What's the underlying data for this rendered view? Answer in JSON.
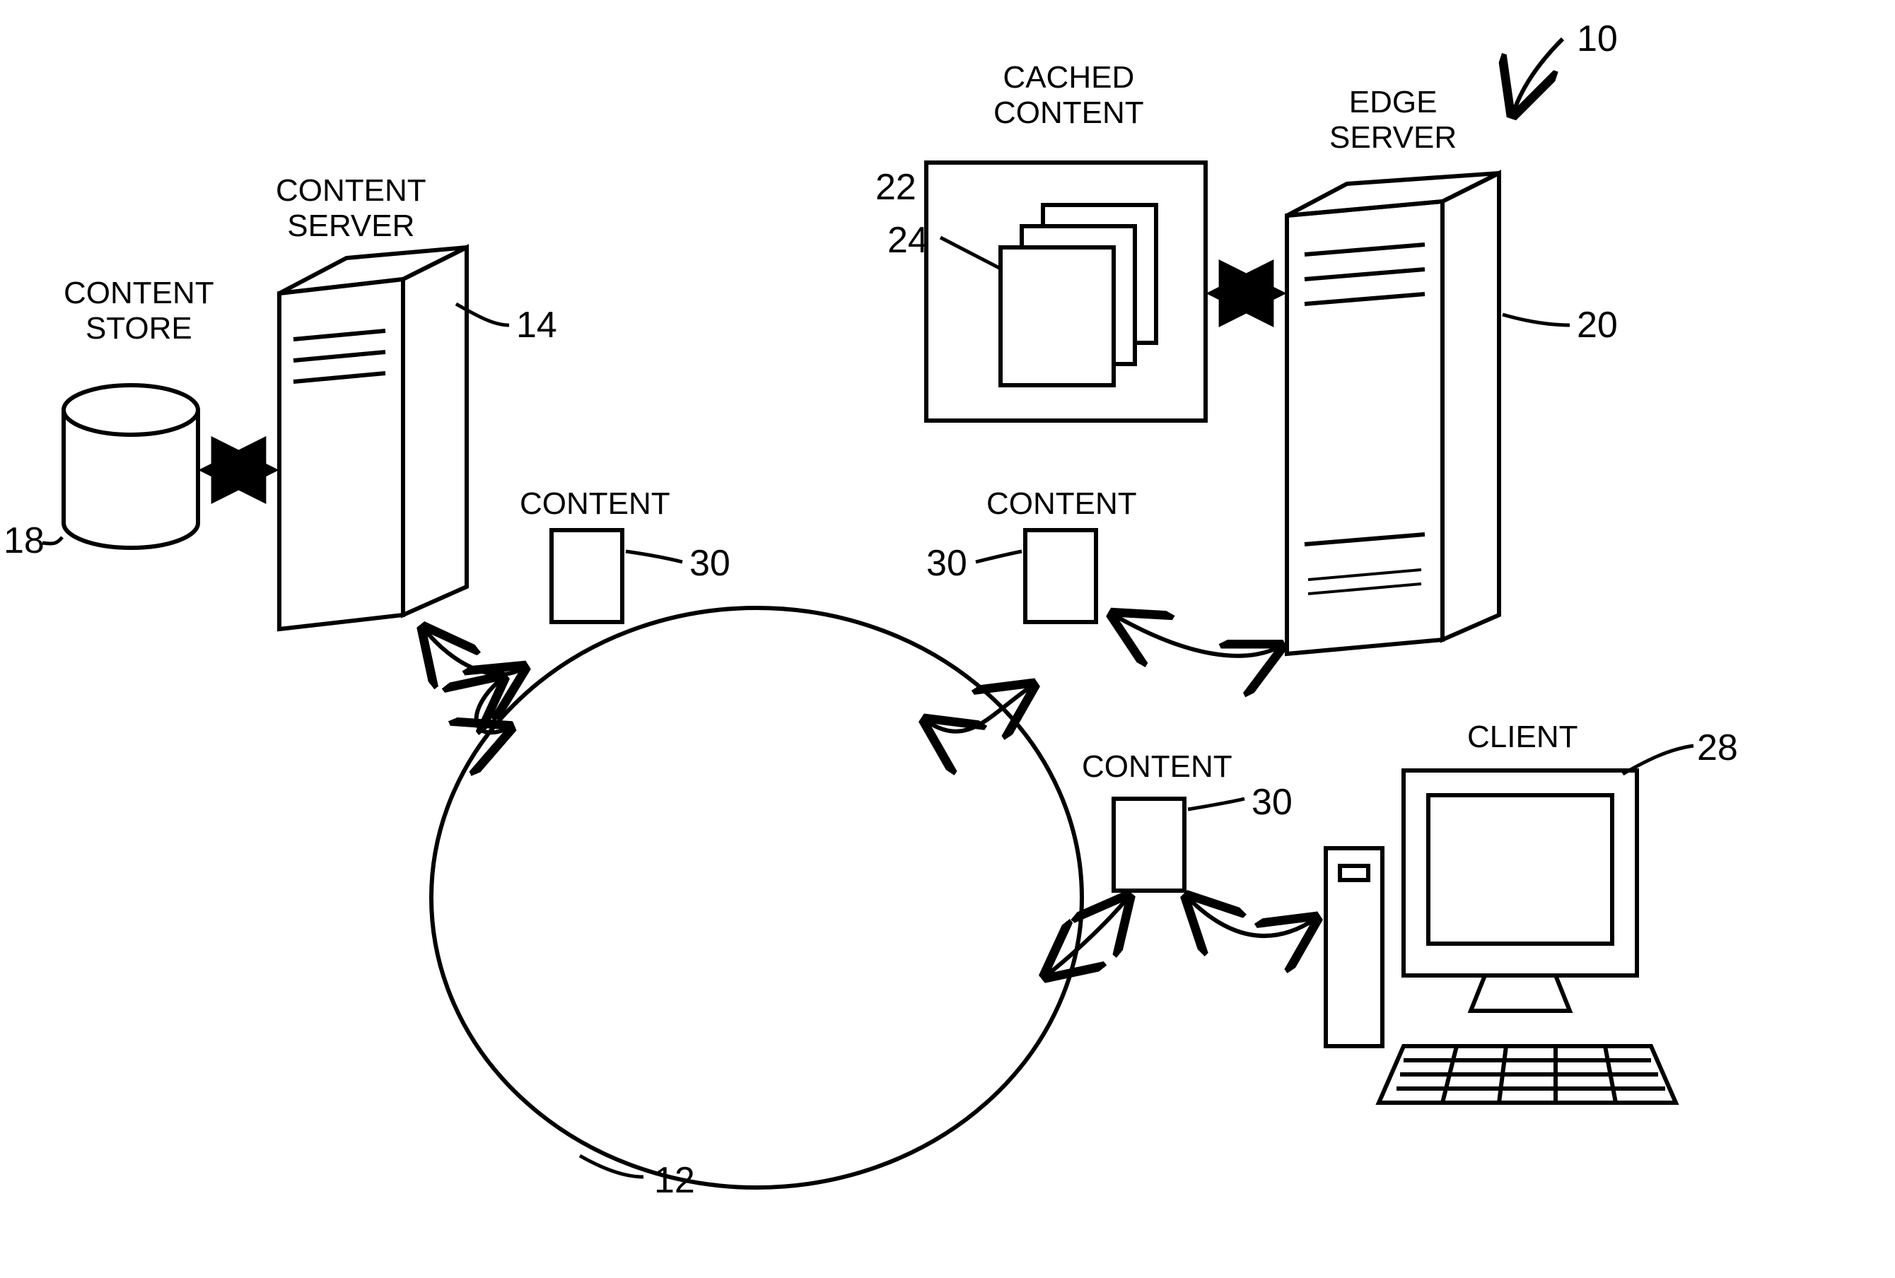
{
  "figure_reference": "10",
  "network": {
    "ref": "12"
  },
  "content_server": {
    "title": "CONTENT\nSERVER",
    "ref": "14"
  },
  "content_store": {
    "title": "CONTENT\nSTORE",
    "ref": "18"
  },
  "edge_server": {
    "title": "EDGE\nSERVER",
    "ref": "20"
  },
  "cached_content": {
    "title": "CACHED\nCONTENT",
    "ref_box": "22",
    "ref_item": "24"
  },
  "client": {
    "title": "CLIENT",
    "ref": "28"
  },
  "content_left": {
    "title": "CONTENT",
    "ref": "30"
  },
  "content_mid": {
    "title": "CONTENT",
    "ref": "30"
  },
  "content_right": {
    "title": "CONTENT",
    "ref": "30"
  }
}
